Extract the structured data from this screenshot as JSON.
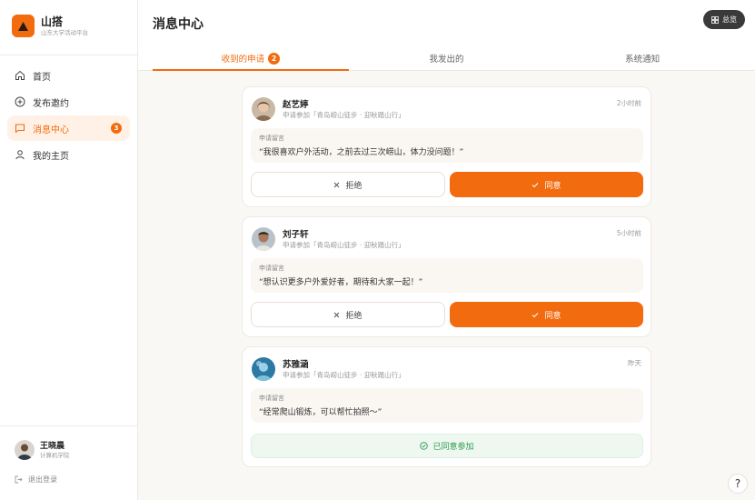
{
  "brand": {
    "name": "山搭",
    "subtitle": "山东大学活动平台"
  },
  "page": {
    "title": "消息中心"
  },
  "sidebar": {
    "items": [
      {
        "label": "首页"
      },
      {
        "label": "发布邀约"
      },
      {
        "label": "消息中心",
        "badge": "3"
      },
      {
        "label": "我的主页"
      }
    ],
    "user": {
      "name": "王晓晨",
      "dept": "计算机学院"
    },
    "logout": "退出登录"
  },
  "header": {
    "overview": "总览"
  },
  "tabs": [
    {
      "label": "收到的申请",
      "badge": "2"
    },
    {
      "label": "我发出的"
    },
    {
      "label": "系统通知"
    }
  ],
  "requests": [
    {
      "name": "赵艺婷",
      "activity": "申请参加「青岛崂山徒步 · 迎秋踏山行」",
      "time": "2小时前",
      "message_label": "申请留言",
      "message": "“我很喜欢户外活动，之前去过三次崂山，体力没问题！”",
      "reject": "拒绝",
      "accept": "同意"
    },
    {
      "name": "刘子轩",
      "activity": "申请参加「青岛崂山徒步 · 迎秋踏山行」",
      "time": "5小时前",
      "message_label": "申请留言",
      "message": "“想认识更多户外爱好者，期待和大家一起！”",
      "reject": "拒绝",
      "accept": "同意"
    },
    {
      "name": "苏雅涵",
      "activity": "申请参加「青岛崂山徒步 · 迎秋踏山行」",
      "time": "昨天",
      "message_label": "申请留言",
      "message": "“经常爬山锻炼，可以帮忙拍照～”",
      "status_label": "已同意参加"
    }
  ],
  "help": "?",
  "colors": {
    "brand": "#F26B0F",
    "bg": "#FAF8F5",
    "approved": "#2E9A50"
  }
}
